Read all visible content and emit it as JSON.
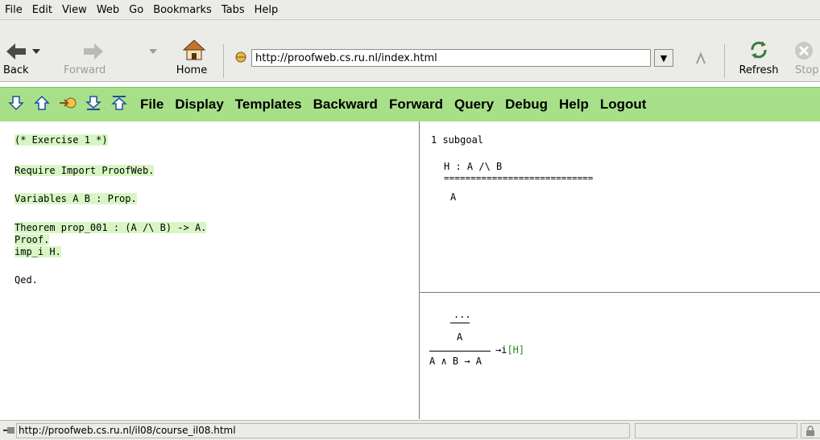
{
  "menubar": [
    "File",
    "Edit",
    "View",
    "Web",
    "Go",
    "Bookmarks",
    "Tabs",
    "Help"
  ],
  "nav": {
    "back": "Back",
    "forward": "Forward",
    "home": "Home",
    "refresh": "Refresh",
    "stop": "Stop",
    "url": "http://proofweb.cs.ru.nl/index.html"
  },
  "proofweb_menu": [
    "File",
    "Display",
    "Templates",
    "Backward",
    "Forward",
    "Query",
    "Debug",
    "Help",
    "Logout"
  ],
  "editor": {
    "comment": "(* Exercise 1 *)",
    "require": "Require Import ProofWeb.",
    "variables": "Variables A B : Prop.",
    "theorem": "Theorem prop_001 : (A /\\ B) -> A.",
    "proof": "Proof.",
    "tactic": "imp_i H.",
    "qed": "Qed."
  },
  "goals": {
    "count": "1 subgoal",
    "hyp": "H : A /\\ B",
    "separator": "============================",
    "goal": "A"
  },
  "tree": {
    "dots": "...",
    "mid": "A",
    "rule": "→i",
    "label": "[H]",
    "bottom": "A ∧ B → A"
  },
  "status": {
    "url": "http://proofweb.cs.ru.nl/il08/course_il08.html"
  },
  "colors": {
    "toolbar_green": "#a8e08a",
    "processed_highlight": "#d8f6c4"
  }
}
